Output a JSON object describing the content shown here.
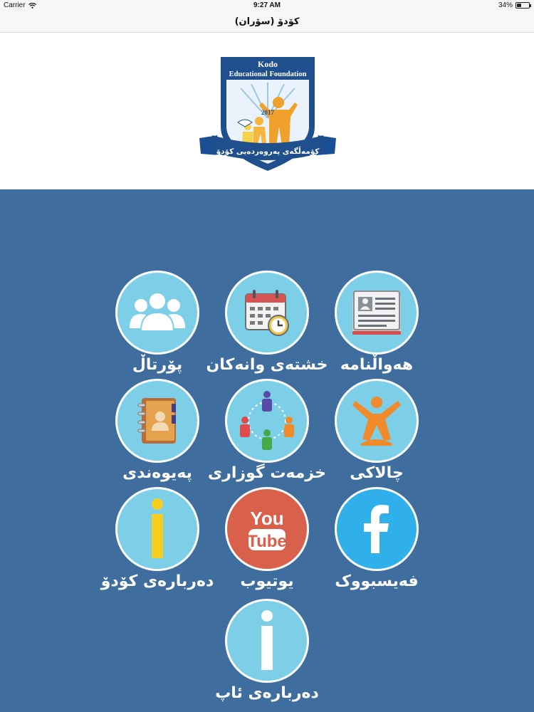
{
  "status": {
    "carrier": "Carrier",
    "time": "9:27 AM",
    "battery": "34%",
    "battery_level": 0.34
  },
  "nav": {
    "title": "کۆدۆ (سۆران)"
  },
  "logo": {
    "name": "Kodo",
    "subtitle": "Educational Foundation",
    "year": "2017",
    "banner": "کۆمەڵگەی پەروەردەیی کۆدۆ"
  },
  "tiles": [
    {
      "label": "هەواڵنامە",
      "icon": "newspaper-icon"
    },
    {
      "label": "خشتەی وانەکان",
      "icon": "calendar-clock-icon"
    },
    {
      "label": "پۆرتاڵ",
      "icon": "people-group-icon"
    },
    {
      "label": "چالاکی",
      "icon": "activity-person-icon"
    },
    {
      "label": "خزمەت گوزاری",
      "icon": "network-people-icon"
    },
    {
      "label": "پەیوەندی",
      "icon": "contact-book-icon"
    },
    {
      "label": "فەیسبووک",
      "icon": "facebook-icon"
    },
    {
      "label": "یوتیوب",
      "icon": "youtube-icon",
      "icon_text_top": "You",
      "icon_text_bottom": "Tube"
    },
    {
      "label": "دەربارەی کۆدۆ",
      "icon": "info-yellow-icon"
    },
    {
      "label": "دەربارەی ئاپ",
      "icon": "info-white-icon"
    }
  ],
  "colors": {
    "main_bg": "#3f6d9d",
    "circle": "#7ccfe6",
    "facebook": "#2fb0ea",
    "youtube": "#d9604a",
    "info_yellow": "#f7cf23"
  }
}
